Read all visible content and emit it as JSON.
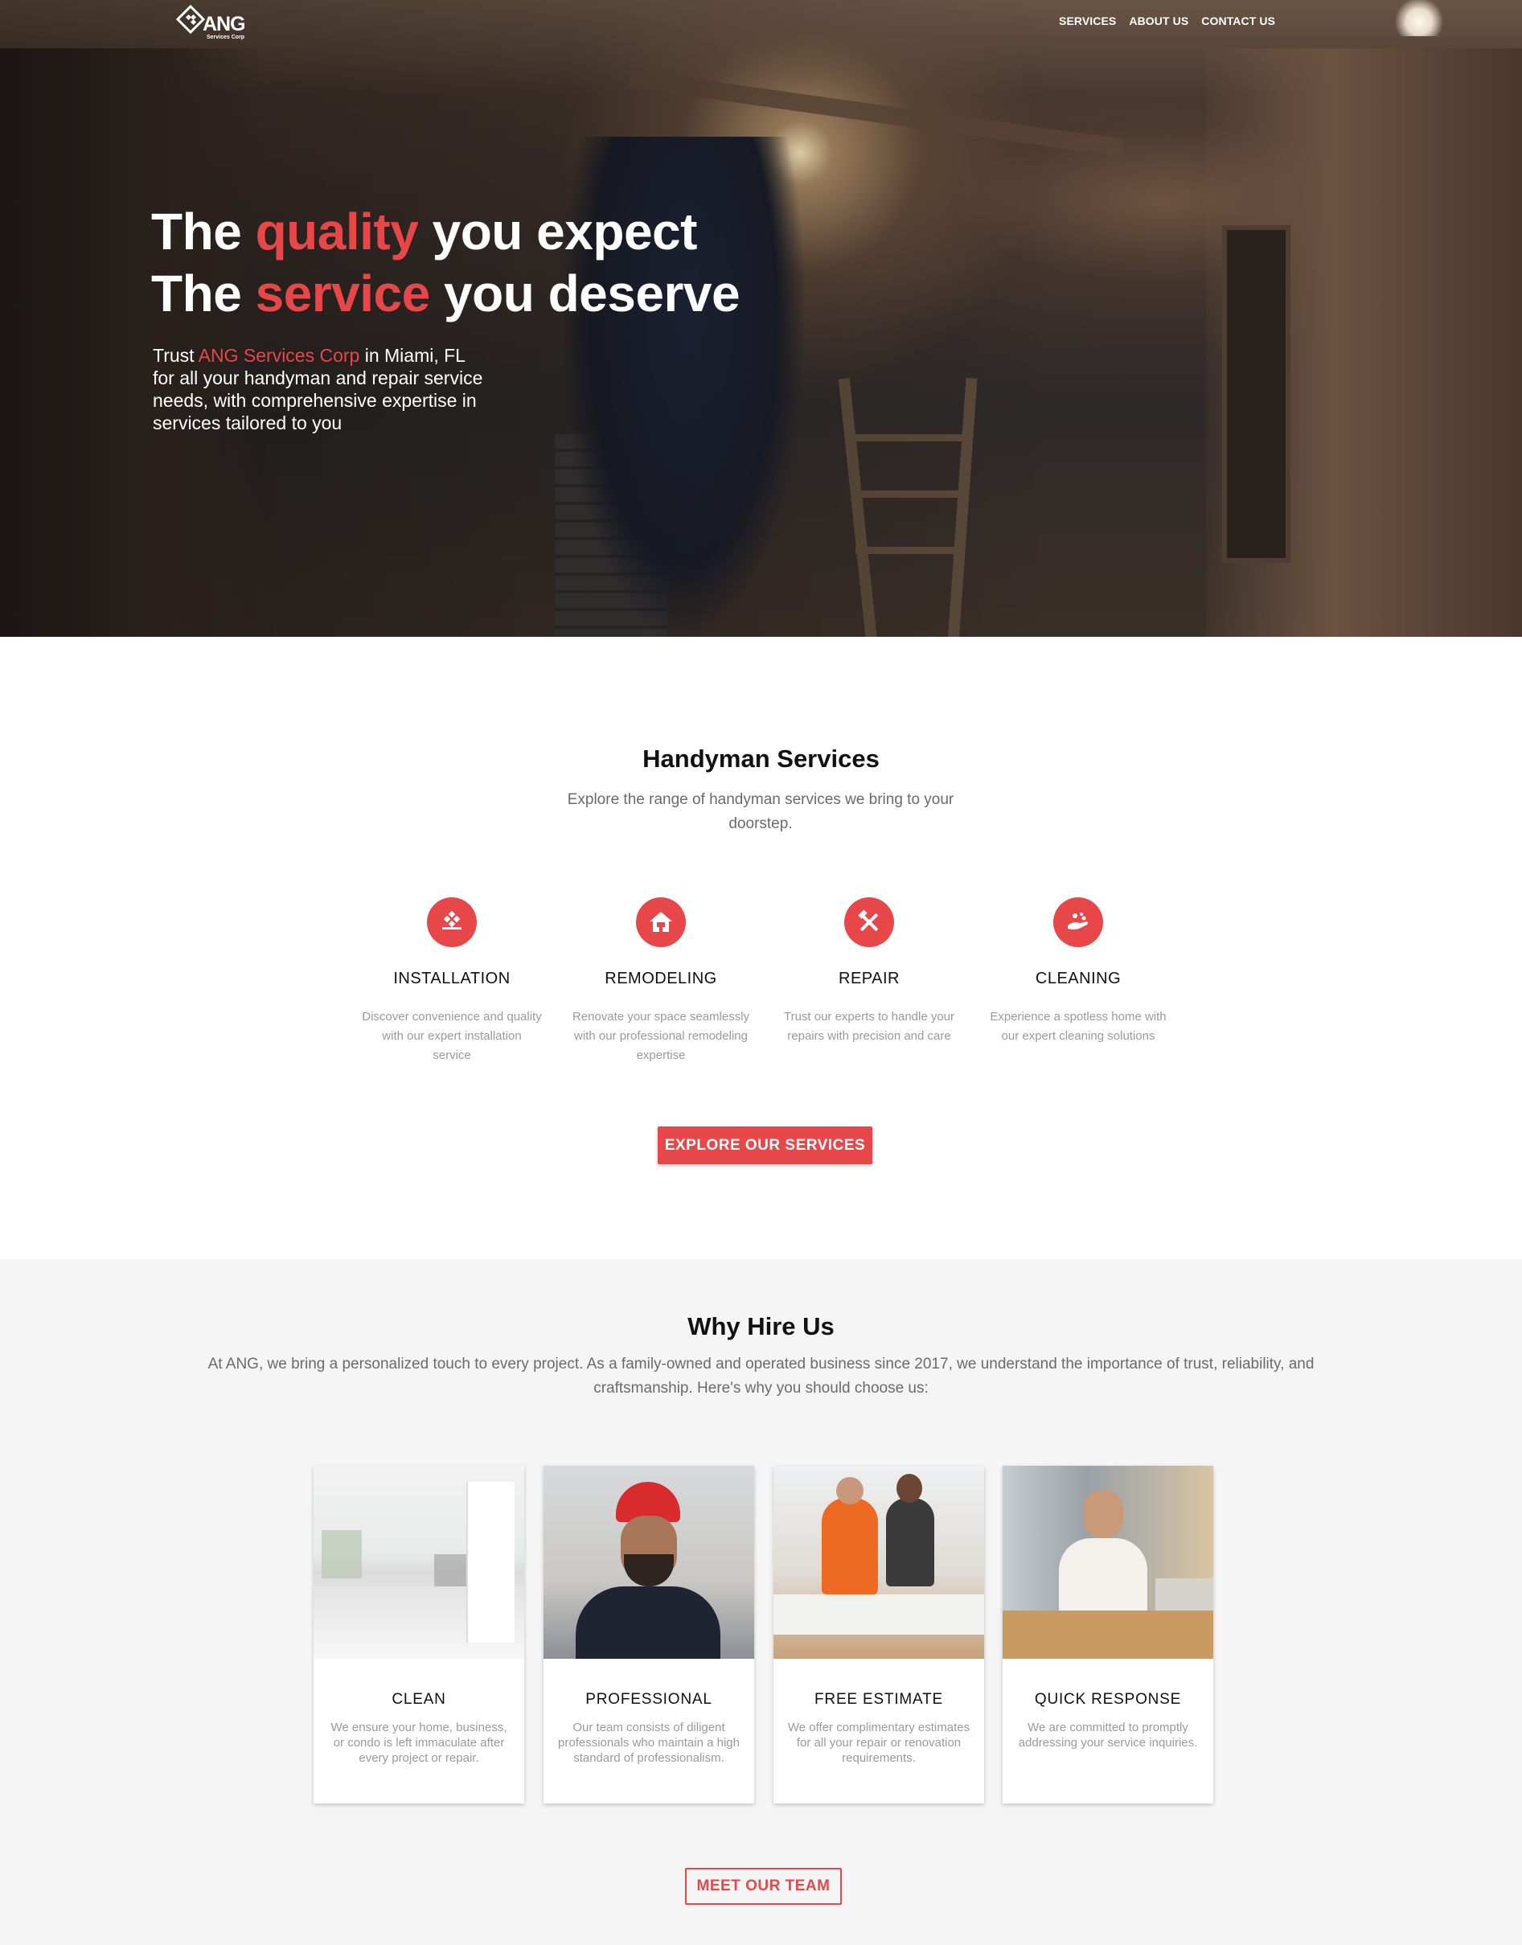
{
  "brand": {
    "logo_word": "ANG",
    "logo_sub": "Services Corp",
    "accent": "#e8474a"
  },
  "nav": {
    "items": [
      {
        "label": "SERVICES"
      },
      {
        "label": "ABOUT US"
      },
      {
        "label": "CONTACT US"
      }
    ]
  },
  "hero": {
    "line1_pre": "The ",
    "line1_hl": "quality",
    "line1_post": " you expect",
    "line2_pre": "The ",
    "line2_hl": "service",
    "line2_post": " you deserve",
    "text_pre": "Trust ",
    "text_hl": "ANG Services Corp",
    "text_post": " in Miami, FL for all your handyman and repair service needs, with comprehensive expertise in services tailored to you"
  },
  "services": {
    "title": "Handyman Services",
    "subtitle": "Explore the range of handyman services we bring to your doorstep.",
    "items": [
      {
        "icon": "tile-install-icon",
        "label": "INSTALLATION",
        "desc": "Discover convenience and quality with our expert installation service"
      },
      {
        "icon": "house-icon",
        "label": "REMODELING",
        "desc": "Renovate your space seamlessly with our professional remodeling expertise"
      },
      {
        "icon": "tools-icon",
        "label": "REPAIR",
        "desc": "Trust our experts to handle your repairs with precision and care"
      },
      {
        "icon": "cleaning-hand-icon",
        "label": "CLEANING",
        "desc": "Experience a spotless home with our expert cleaning solutions"
      }
    ],
    "cta": "EXPLORE OUR SERVICES"
  },
  "why": {
    "title": "Why Hire Us",
    "subtitle": "At ANG, we bring a personalized touch to every project. As a family-owned and operated business since 2017, we understand the importance of trust, reliability, and craftsmanship. Here's why you should choose us:",
    "cards": [
      {
        "title": "CLEAN",
        "desc": "We ensure your home, business, or condo is left immaculate after every project or repair."
      },
      {
        "title": "PROFESSIONAL",
        "desc": "Our team consists of diligent professionals who maintain a high standard of professionalism."
      },
      {
        "title": "FREE ESTIMATE",
        "desc": "We offer complimentary estimates for all your repair or renovation requirements."
      },
      {
        "title": "QUICK RESPONSE",
        "desc": "We are committed to promptly addressing your service inquiries."
      }
    ],
    "cta": "MEET OUR TEAM"
  }
}
